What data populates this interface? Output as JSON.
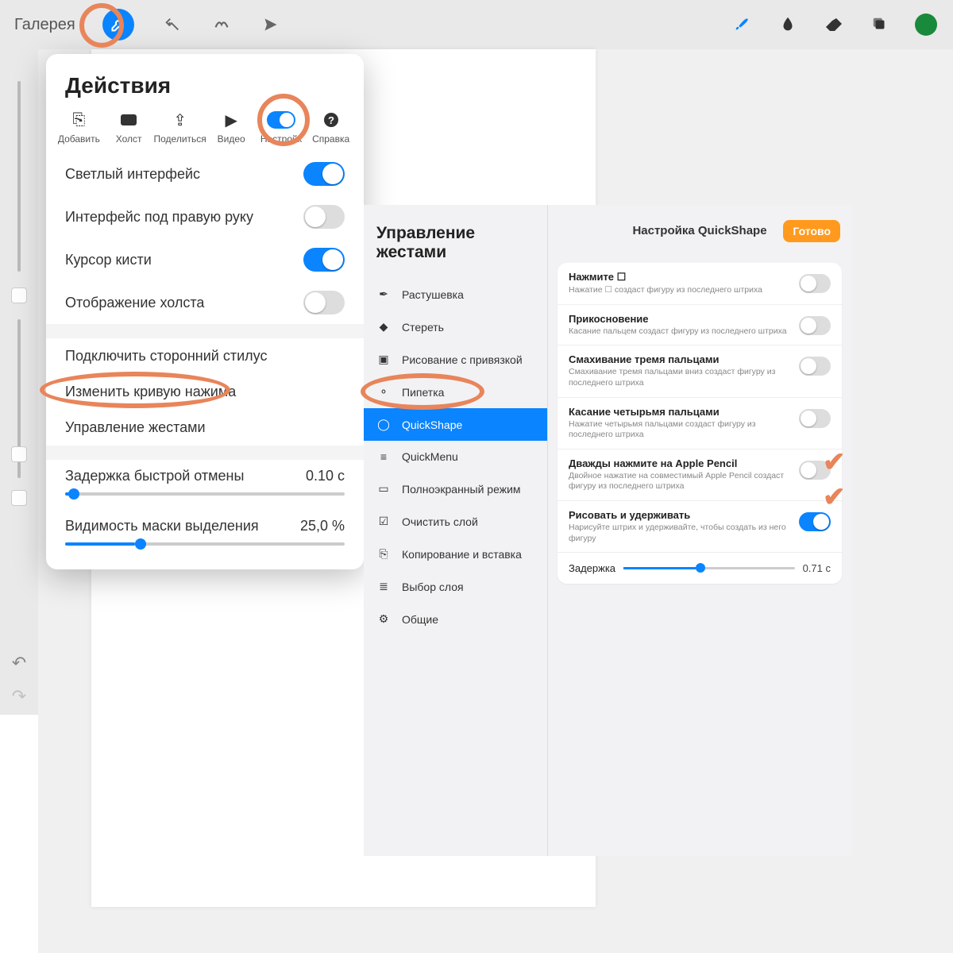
{
  "toolbar": {
    "gallery": "Галерея"
  },
  "actions": {
    "title": "Действия",
    "tabs": {
      "add": "Добавить",
      "canvas": "Холст",
      "share": "Поделиться",
      "video": "Видео",
      "settings": "Настройк",
      "help": "Справка"
    },
    "toggles": {
      "light_ui": "Светлый интерфейс",
      "right_hand": "Интерфейс под правую руку",
      "brush_cursor": "Курсор кисти",
      "canvas_view": "Отображение холста"
    },
    "links": {
      "connect_stylus": "Подключить сторонний стилус",
      "pressure_curve": "Изменить кривую нажима",
      "gesture_control": "Управление жестами"
    },
    "sliders": {
      "undo_delay_label": "Задержка быстрой отмены",
      "undo_delay_value": "0.10 с",
      "mask_visibility_label": "Видимость маски выделения",
      "mask_visibility_value": "25,0 %"
    }
  },
  "gestures": {
    "title": "Управление жестами",
    "items": {
      "smudge": "Растушевка",
      "erase": "Стереть",
      "assisted": "Рисование с привязкой",
      "eyedropper": "Пипетка",
      "quickshape": "QuickShape",
      "quickmenu": "QuickMenu",
      "fullscreen": "Полноэкранный режим",
      "clear": "Очистить слой",
      "copypaste": "Копирование и вставка",
      "layerselect": "Выбор слоя",
      "general": "Общие"
    }
  },
  "quickshape": {
    "title": "Настройка QuickShape",
    "done": "Готово",
    "rows": {
      "tap": {
        "t": "Нажмите ☐",
        "s": "Нажатие ☐ создаст фигуру из последнего штриха"
      },
      "touch": {
        "t": "Прикосновение",
        "s": "Касание пальцем создаст фигуру из последнего штриха"
      },
      "swipe3": {
        "t": "Смахивание тремя пальцами",
        "s": "Смахивание тремя пальцами вниз создаст фигуру из последнего штриха"
      },
      "tap4": {
        "t": "Касание четырьмя пальцами",
        "s": "Нажатие четырьмя пальцами создаст фигуру из последнего штриха"
      },
      "pencil2": {
        "t": "Дважды нажмите на Apple Pencil",
        "s": "Двойное нажатие на совместимый Apple Pencil создаст фигуру из последнего штриха"
      },
      "hold": {
        "t": "Рисовать и удерживать",
        "s": "Нарисуйте штрих и удерживайте, чтобы создать из него фигуру"
      }
    },
    "delay": {
      "label": "Задержка",
      "value": "0.71 с"
    }
  }
}
